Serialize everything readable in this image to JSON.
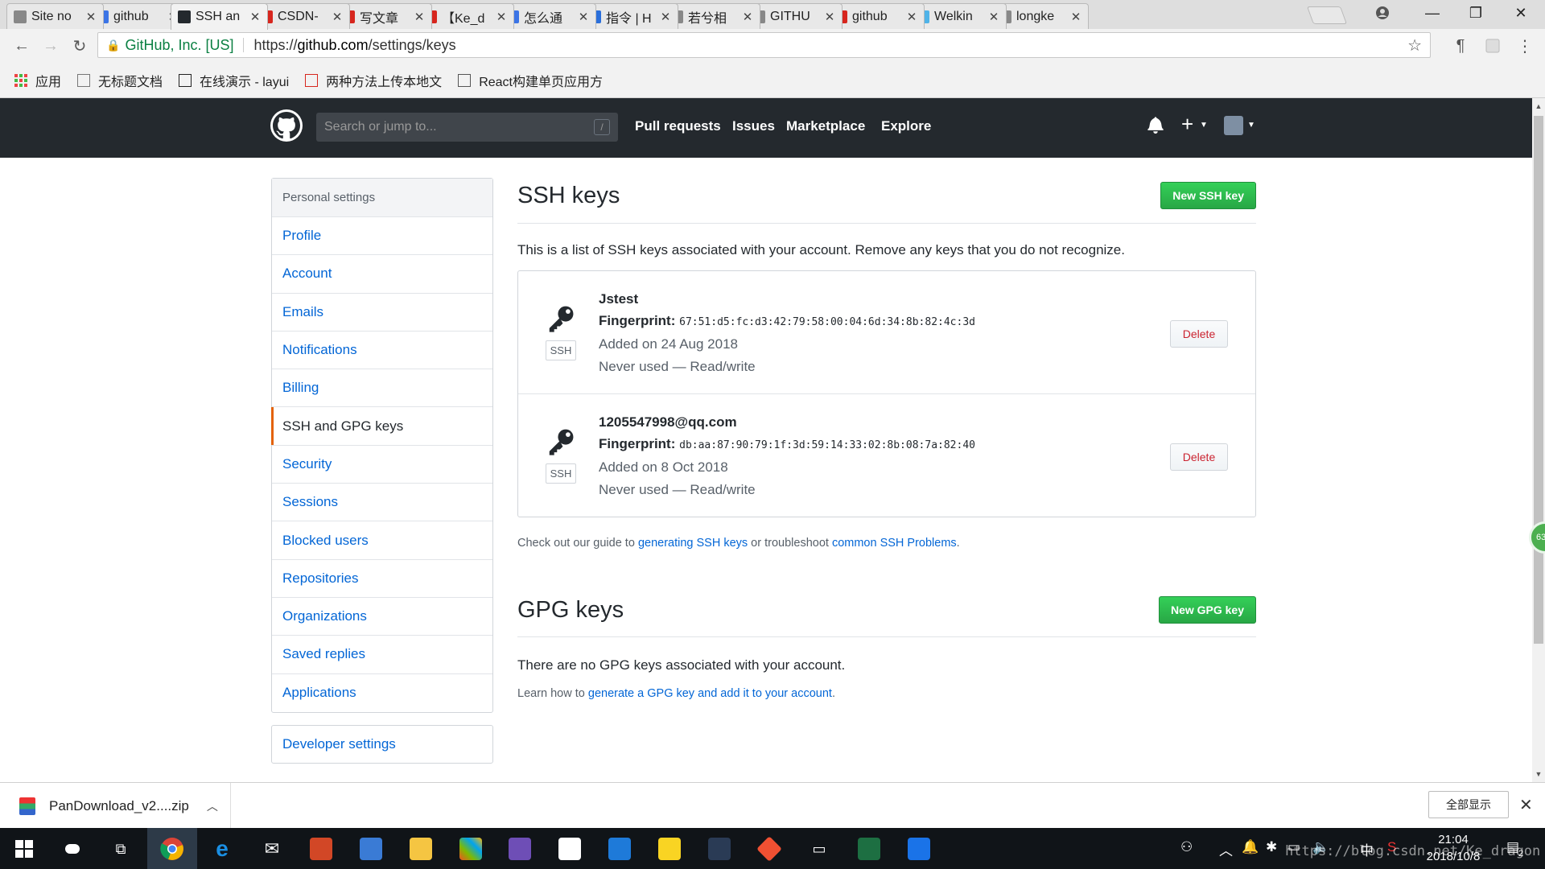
{
  "browser": {
    "tabs": [
      {
        "title": "Site no",
        "icon_color": "#888888",
        "icon": "page-icon"
      },
      {
        "title": "github",
        "icon_color": "#3b74e6",
        "icon": "paw-icon"
      },
      {
        "title": "SSH an",
        "icon_color": "#24292e",
        "icon": "github-icon"
      },
      {
        "title": "CSDN-",
        "icon_color": "#d7261e",
        "icon": "csdn-icon"
      },
      {
        "title": "写文章",
        "icon_color": "#d7261e",
        "icon": "csdn-icon"
      },
      {
        "title": "【Ke_d",
        "icon_color": "#d7261e",
        "icon": "csdn-icon"
      },
      {
        "title": "怎么通",
        "icon_color": "#3b74e6",
        "icon": "paw-icon"
      },
      {
        "title": "指令 | H",
        "icon_color": "#2a6fdb",
        "icon": "h-icon"
      },
      {
        "title": "若兮相",
        "icon_color": "#888888",
        "icon": "page-icon"
      },
      {
        "title": "GITHU",
        "icon_color": "#888888",
        "icon": "feather-icon"
      },
      {
        "title": "github",
        "icon_color": "#d7261e",
        "icon": "csdn-icon"
      },
      {
        "title": "Welkin",
        "icon_color": "#4fb3e8",
        "icon": "cloud-icon"
      },
      {
        "title": "longke",
        "icon_color": "#888888",
        "icon": "page-icon"
      }
    ],
    "active_tab": 2,
    "close_glyph": "✕",
    "address": {
      "secure_label": "GitHub, Inc. [US]",
      "url_scheme": "https://",
      "url_domain": "github.com",
      "url_path": "/settings/keys"
    },
    "bookmarks": [
      {
        "label": "应用",
        "icon": "apps-grid-icon"
      },
      {
        "label": "无标题文档",
        "icon": "page-icon"
      },
      {
        "label": "在线演示 - layui",
        "icon": "layui-icon"
      },
      {
        "label": "两种方法上传本地文",
        "icon": "csdn-icon"
      },
      {
        "label": "React构建单页应用方",
        "icon": "feather-icon"
      }
    ]
  },
  "header": {
    "search_placeholder": "Search or jump to...",
    "search_shortcut": "/",
    "nav": [
      "Pull requests",
      "Issues",
      "Marketplace",
      "Explore"
    ]
  },
  "sidebar": {
    "heading": "Personal settings",
    "items": [
      {
        "label": "Profile"
      },
      {
        "label": "Account"
      },
      {
        "label": "Emails"
      },
      {
        "label": "Notifications"
      },
      {
        "label": "Billing"
      },
      {
        "label": "SSH and GPG keys",
        "selected": true
      },
      {
        "label": "Security"
      },
      {
        "label": "Sessions"
      },
      {
        "label": "Blocked users"
      },
      {
        "label": "Repositories"
      },
      {
        "label": "Organizations"
      },
      {
        "label": "Saved replies"
      },
      {
        "label": "Applications"
      }
    ],
    "developer_settings": "Developer settings",
    "selected_accent": "#e36209"
  },
  "ssh": {
    "title": "SSH keys",
    "new_button": "New SSH key",
    "description": "This is a list of SSH keys associated with your account. Remove any keys that you do not recognize.",
    "keys": [
      {
        "title": "Jstest",
        "fingerprint_label": "Fingerprint:",
        "fingerprint": "67:51:d5:fc:d3:42:79:58:00:04:6d:34:8b:82:4c:3d",
        "added": "Added on 24 Aug 2018",
        "usage": "Never used — Read/write",
        "badge": "SSH",
        "delete_label": "Delete"
      },
      {
        "title": "1205547998@qq.com",
        "fingerprint_label": "Fingerprint:",
        "fingerprint": "db:aa:87:90:79:1f:3d:59:14:33:02:8b:08:7a:82:40",
        "added": "Added on 8 Oct 2018",
        "usage": "Never used — Read/write",
        "badge": "SSH",
        "delete_label": "Delete"
      }
    ],
    "help_prefix": "Check out our guide to ",
    "help_link1": "generating SSH keys",
    "help_middle": " or troubleshoot ",
    "help_link2": "common SSH Problems",
    "help_suffix": "."
  },
  "gpg": {
    "title": "GPG keys",
    "new_button": "New GPG key",
    "empty_text": "There are no GPG keys associated with your account.",
    "help_prefix": "Learn how to ",
    "help_link": "generate a GPG key and add it to your account",
    "help_suffix": "."
  },
  "floating_badge": "63",
  "download": {
    "filename": "PanDownload_v2....zip",
    "show_all": "全部显示"
  },
  "taskbar": {
    "time": "21:04",
    "date": "2018/10/8",
    "ime": "中",
    "notification_count": "2",
    "watermark": "https://blog.csdn.net/Ke_dragon"
  },
  "colors": {
    "github_header": "#24292e",
    "link": "#0366d6",
    "green_button": "#28a745",
    "delete_text": "#cb2431"
  }
}
